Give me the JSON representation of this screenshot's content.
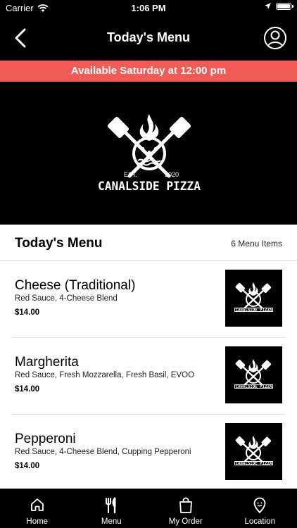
{
  "status_bar": {
    "carrier": "Carrier",
    "time": "1:06 PM"
  },
  "header": {
    "title": "Today's Menu"
  },
  "banner": {
    "text": "Available Saturday at 12:00 pm"
  },
  "hero": {
    "est": "EST.",
    "year": "2020",
    "brand": "CANALSIDE PIZZA"
  },
  "section": {
    "title": "Today's Menu",
    "count": "6 Menu Items"
  },
  "items": [
    {
      "name": "Cheese (Traditional)",
      "description": "Red Sauce, 4-Cheese Blend",
      "price": "$14.00"
    },
    {
      "name": "Margherita",
      "description": "Red Sauce, Fresh Mozzarella, Fresh Basil, EVOO",
      "price": "$14.00"
    },
    {
      "name": "Pepperoni",
      "description": "Red Sauce, 4-Cheese Blend, Cupping Pepperoni",
      "price": "$14.00"
    }
  ],
  "tabs": [
    {
      "label": "Home",
      "icon": "home-icon"
    },
    {
      "label": "Menu",
      "icon": "utensils-icon"
    },
    {
      "label": "My Order",
      "icon": "bag-icon"
    },
    {
      "label": "Location",
      "icon": "location-pin-icon"
    }
  ],
  "colors": {
    "banner": "#f25a55",
    "bar": "#000000",
    "text": "#000000"
  }
}
